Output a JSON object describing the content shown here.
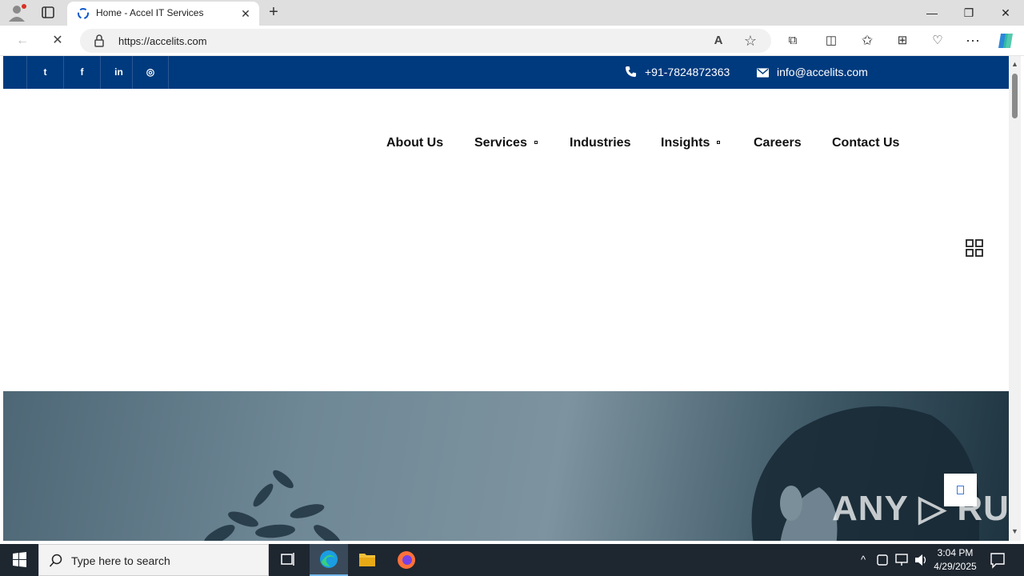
{
  "browser": {
    "tab_title": "Home - Accel IT Services",
    "url": "https://accelits.com",
    "tab_close": "✕",
    "new_tab": "+",
    "window_controls": {
      "minimize": "—",
      "restore": "❐",
      "close": "✕"
    },
    "nav": {
      "back": "←",
      "stop": "✕"
    },
    "toolbar_icons": {
      "read_aloud": "A",
      "favorite": "☆",
      "extensions": "⧉",
      "split": "◫",
      "favorites": "✩",
      "collections": "⊞",
      "performance": "♡",
      "more": "⋯"
    }
  },
  "site": {
    "social": [
      {
        "name": "twitter-link",
        "glyph": "t"
      },
      {
        "name": "facebook-link",
        "glyph": "f"
      },
      {
        "name": "linkedin-link",
        "glyph": "in"
      },
      {
        "name": "instagram-link",
        "glyph": "◎"
      }
    ],
    "phone": "+91-7824872363",
    "email": "info@accelits.com",
    "nav": {
      "about": "About Us",
      "services": "Services",
      "industries": "Industries",
      "insights": "Insights",
      "careers": "Careers",
      "contact": "Contact Us"
    }
  },
  "watermark": "ANY ▷ RUN",
  "taskbar": {
    "search_placeholder": "Type here to search",
    "time": "3:04 PM",
    "date": "4/29/2025"
  },
  "colors": {
    "topbar": "#003a7e",
    "accent": "#3a7bd5"
  }
}
